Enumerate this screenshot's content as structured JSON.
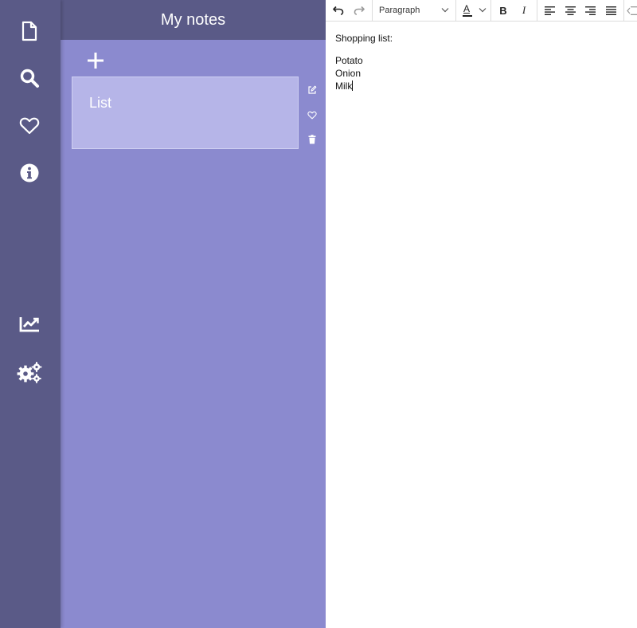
{
  "sidebar": {
    "icons": [
      "file-icon",
      "search-icon",
      "heart-icon",
      "info-icon",
      "chart-icon",
      "settings-icon"
    ]
  },
  "notes": {
    "title": "My notes",
    "items": [
      {
        "title": "List"
      }
    ]
  },
  "toolbar": {
    "format_select": "Paragraph",
    "font_color_label": "A"
  },
  "editor": {
    "heading": "Shopping list:",
    "lines": [
      "Potato",
      "Onion",
      "Milk"
    ]
  },
  "colors": {
    "sidebar_bg": "#5a5a87",
    "panel_bg": "#8b8acf",
    "card_bg": "#b6b5e8"
  }
}
